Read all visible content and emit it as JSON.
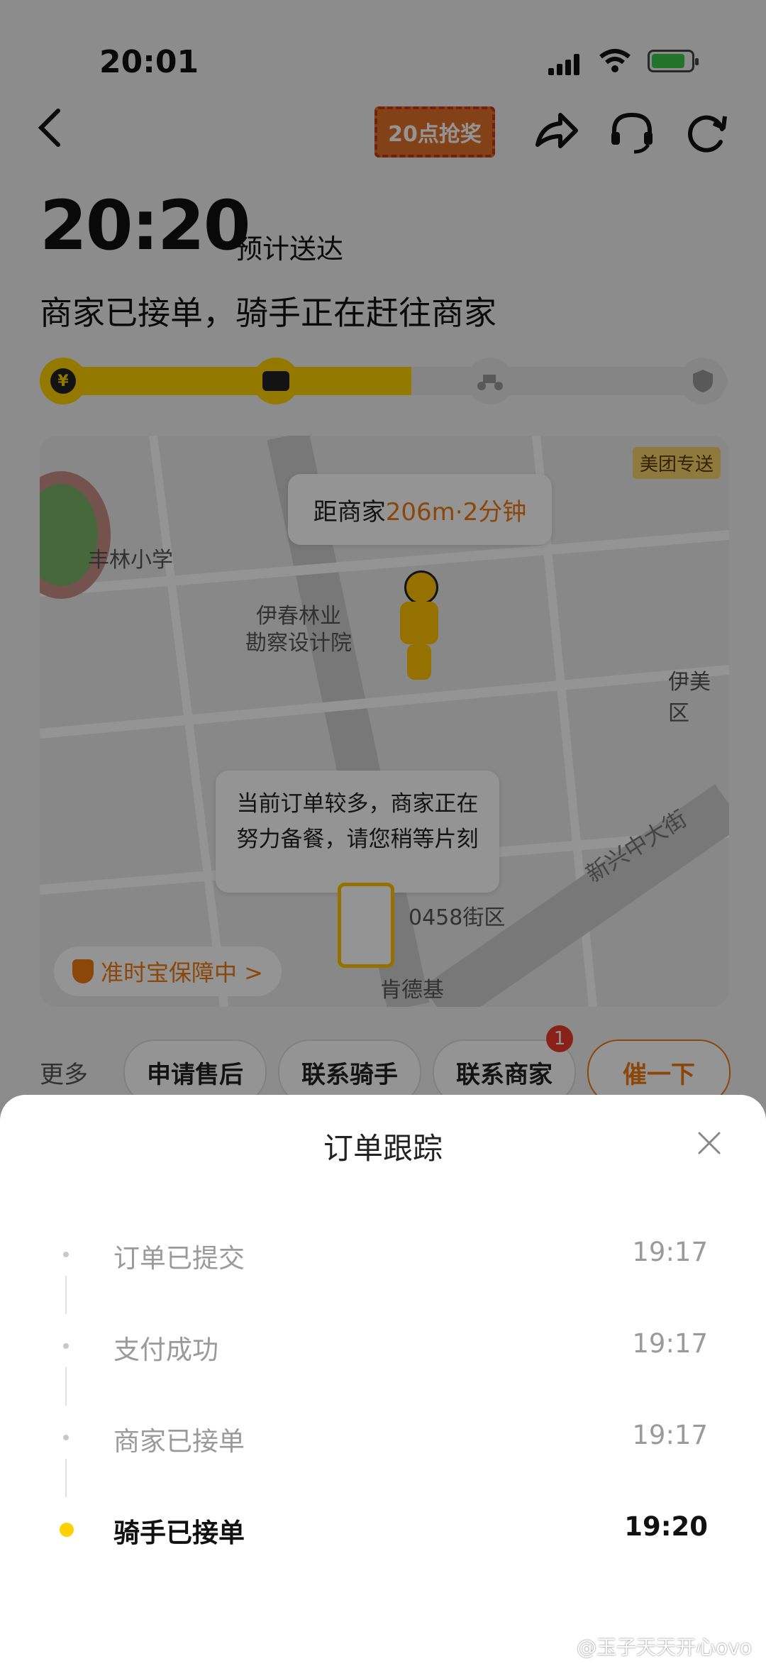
{
  "status_bar": {
    "time": "20:01"
  },
  "header": {
    "banner_text": "20点抢奖",
    "eta_time": "20:20",
    "eta_label": "预计送达",
    "status_title": "商家已接单，骑手正在赶往商家",
    "progress_percent": 54
  },
  "map": {
    "badge": "美团专送",
    "distance_prefix": "距商家",
    "distance_value": "206m·2分钟",
    "poi_school": "丰林小学",
    "poi_institute_1": "伊春林业",
    "poi_institute_2": "勘察设计院",
    "poi_right": "伊美区",
    "street": "新兴中大街",
    "poi_street_no": "0458街区",
    "poi_kfc": "肯德基",
    "notice_line1": "当前订单较多，商家正在",
    "notice_line2": "努力备餐，请您稍等片刻",
    "guarantee": "准时宝保障中 >"
  },
  "actions": {
    "more": "更多",
    "after_sale": "申请售后",
    "contact_rider": "联系骑手",
    "contact_merchant": "联系商家",
    "merchant_badge": "1",
    "urge": "催一下"
  },
  "sheet": {
    "title": "订单跟踪",
    "events": [
      {
        "label": "订单已提交",
        "time": "19:17"
      },
      {
        "label": "支付成功",
        "time": "19:17"
      },
      {
        "label": "商家已接单",
        "time": "19:17"
      },
      {
        "label": "骑手已接单",
        "time": "19:20"
      }
    ]
  },
  "watermark": "@玉子天天开心ovo",
  "colors": {
    "accent": "#ffd100",
    "orange": "#f07a12",
    "overlay": "rgba(0,0,0,0.42)"
  }
}
